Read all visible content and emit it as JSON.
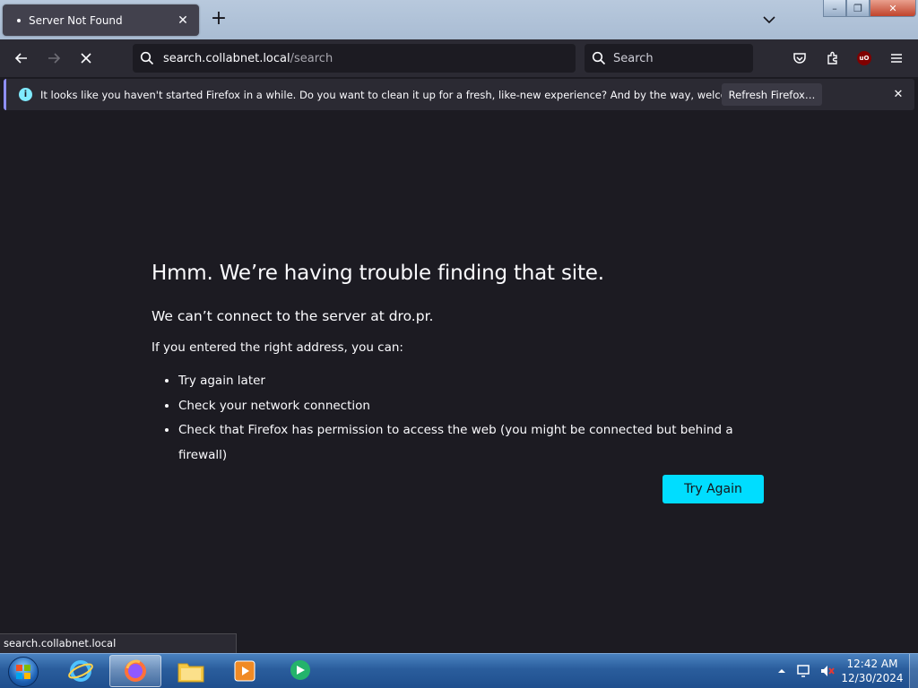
{
  "window": {
    "tab_title": "Server Not Found",
    "new_tab_label": "+",
    "min_glyph": "–",
    "max_glyph": "❐",
    "close_glyph": "✕"
  },
  "toolbar": {
    "url_host": "search.collabnet.local",
    "url_path": "/search",
    "search_placeholder": "Search"
  },
  "notification": {
    "message": "It looks like you haven't started Firefox in a while. Do you want to clean it up for a fresh, like-new experience? And by the way, welcome back!",
    "button_label": "Refresh Firefox…",
    "close_glyph": "✕",
    "info_glyph": "i"
  },
  "error_page": {
    "title": "Hmm. We’re having trouble finding that site.",
    "subtitle": "We can’t connect to the server at dro.pr.",
    "lead": "If you entered the right address, you can:",
    "suggestions": [
      "Try again later",
      "Check your network connection",
      "Check that Firefox has permission to access the web (you might be connected but behind a firewall)"
    ],
    "try_again_label": "Try Again"
  },
  "status_bar": {
    "text": "search.collabnet.local"
  },
  "ublock_badge": "uO",
  "taskbar": {
    "time": "12:42 AM",
    "date": "12/30/2024"
  },
  "colors": {
    "page_bg": "#1c1b22",
    "toolbar_bg": "#2b2a33",
    "accent_button": "#00ddff",
    "info_icon": "#80ebff"
  }
}
